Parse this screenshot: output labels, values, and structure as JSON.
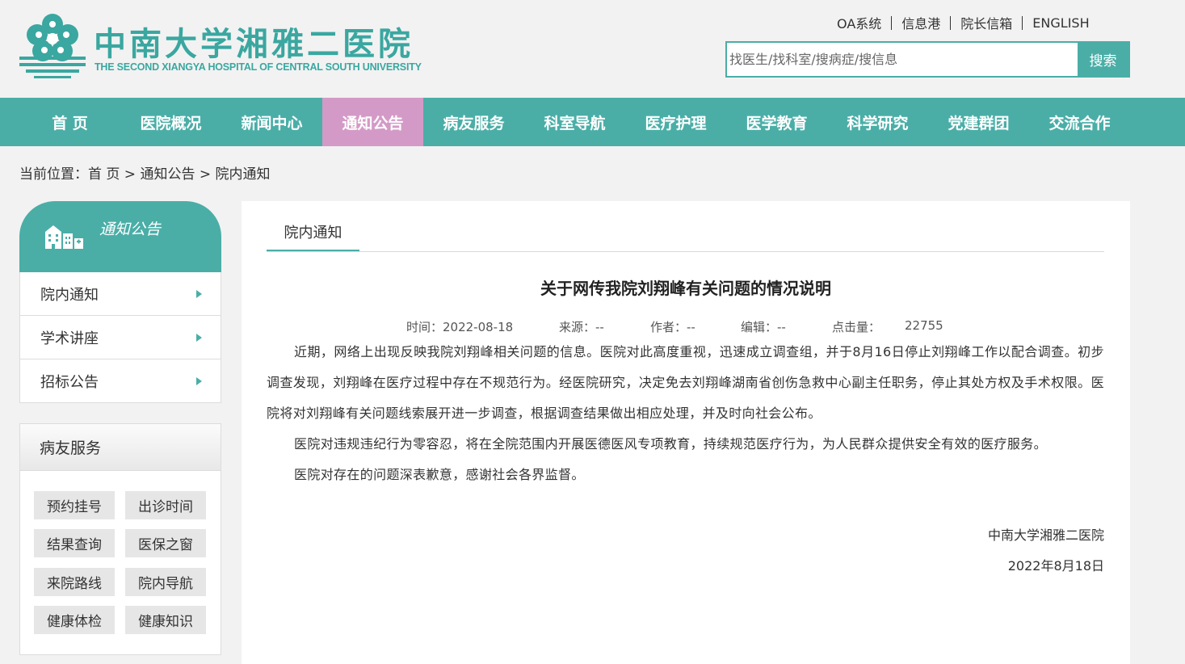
{
  "header": {
    "cn_name": "中南大学湘雅二医院",
    "en_name": "THE SECOND XIANGYA HOSPITAL OF CENTRAL SOUTH UNIVERSITY",
    "top_links": [
      "OA系统",
      "信息港",
      "院长信箱",
      "ENGLISH"
    ],
    "search_placeholder": "找医生/找科室/搜病症/搜信息",
    "search_button": "搜索"
  },
  "nav": {
    "items": [
      "首 页",
      "医院概况",
      "新闻中心",
      "通知公告",
      "病友服务",
      "科室导航",
      "医疗护理",
      "医学教育",
      "科学研究",
      "党建群团",
      "交流合作"
    ],
    "active_index": 3
  },
  "breadcrumb": {
    "prefix": "当前位置：",
    "items": [
      "首 页",
      "通知公告",
      "院内通知"
    ],
    "separator": " > "
  },
  "sidebar": {
    "title": "通知公告",
    "menu": [
      "院内通知",
      "学术讲座",
      "招标公告"
    ],
    "service_title": "病友服务",
    "services": [
      "预约挂号",
      "出诊时间",
      "结果查询",
      "医保之窗",
      "来院路线",
      "院内导航",
      "健康体检",
      "健康知识"
    ]
  },
  "article": {
    "tab": "院内通知",
    "title": "关于网传我院刘翔峰有关问题的情况说明",
    "meta": {
      "time": "时间：2022-08-18",
      "source": "来源：--",
      "author": "作者：--",
      "editor": "编辑：--",
      "views_label": "点击量：",
      "views": "22755"
    },
    "paragraphs": [
      "近期，网络上出现反映我院刘翔峰相关问题的信息。医院对此高度重视，迅速成立调查组，并于8月16日停止刘翔峰工作以配合调查。初步调查发现，刘翔峰在医疗过程中存在不规范行为。经医院研究，决定免去刘翔峰湖南省创伤急救中心副主任职务，停止其处方权及手术权限。医院将对刘翔峰有关问题线索展开进一步调查，根据调查结果做出相应处理，并及时向社会公布。",
      "医院对违规违纪行为零容忍，将在全院范围内开展医德医风专项教育，持续规范医疗行为，为人民群众提供安全有效的医疗服务。",
      "医院对存在的问题深表歉意，感谢社会各界监督。"
    ],
    "signature": "中南大学湘雅二医院",
    "date": "2022年8月18日"
  },
  "colors": {
    "brand": "#4aaea7",
    "nav_active": "#d49ac7",
    "logo_text": "#3aa7a0"
  }
}
